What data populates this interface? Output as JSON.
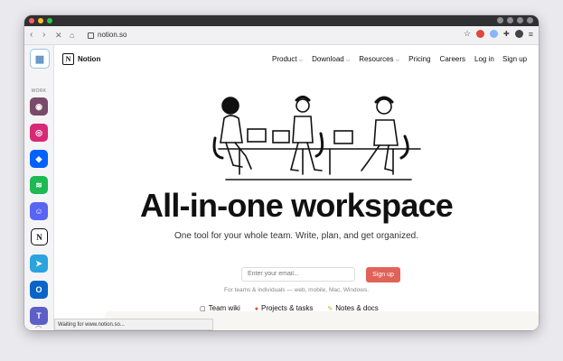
{
  "browser": {
    "url": "notion.so",
    "status_text": "Waiting for www.notion.so..."
  },
  "sidebar": {
    "section_label": "WORK",
    "apps": [
      {
        "name": "workspaces-icon",
        "color": "#ffffff"
      },
      {
        "name": "avatar-app-icon",
        "color": "#7a4a6a"
      },
      {
        "name": "instagram-icon",
        "color": "#d62976"
      },
      {
        "name": "dropbox-icon",
        "color": "#0061ff"
      },
      {
        "name": "spotify-icon",
        "color": "#1db954"
      },
      {
        "name": "discord-icon",
        "color": "#5865f2"
      },
      {
        "name": "notion-icon",
        "color": "#ffffff"
      },
      {
        "name": "telegram-icon",
        "color": "#2aa3df"
      },
      {
        "name": "outlook-icon",
        "color": "#0a64c8"
      },
      {
        "name": "teams-icon",
        "color": "#5b5fc7"
      }
    ]
  },
  "nav": {
    "brand": "Notion",
    "links": [
      {
        "label": "Product",
        "dropdown": true
      },
      {
        "label": "Download",
        "dropdown": true
      },
      {
        "label": "Resources",
        "dropdown": true
      },
      {
        "label": "Pricing",
        "dropdown": false
      },
      {
        "label": "Careers",
        "dropdown": false
      }
    ],
    "login": "Log in",
    "signup": "Sign up"
  },
  "hero": {
    "headline": "All-in-one workspace",
    "subheadline": "One tool for your whole team. Write, plan, and get organized.",
    "email_placeholder": "Enter your email...",
    "signup_button": "Sign up",
    "note": "For teams & individuals — web, mobile, Mac, Windows."
  },
  "feature_tabs": [
    {
      "icon": "book-icon",
      "label": "Team wiki"
    },
    {
      "icon": "pin-icon",
      "label": "Projects & tasks"
    },
    {
      "icon": "pencil-icon",
      "label": "Notes & docs"
    }
  ],
  "colors": {
    "accent": "#e16259"
  }
}
